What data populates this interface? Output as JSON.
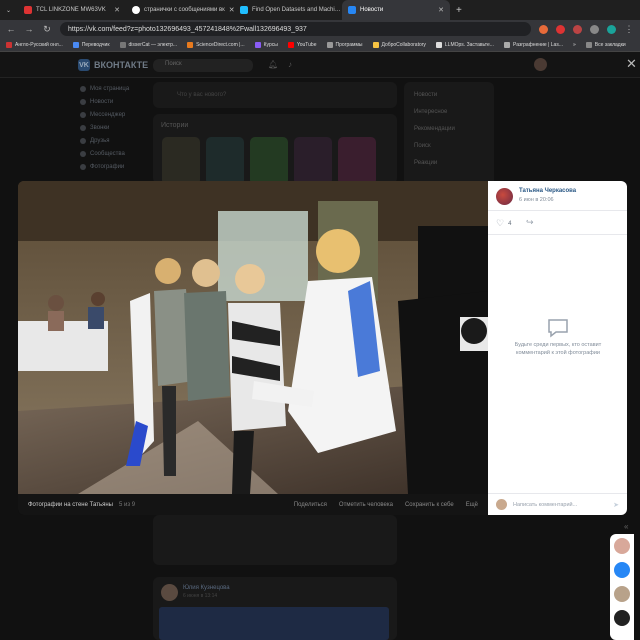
{
  "browser": {
    "tabs": [
      {
        "title": "TCL LINKZONE MW63VK",
        "color": "#d33"
      },
      {
        "title": "странички с сообщениями вк",
        "color": "#fff"
      },
      {
        "title": "Find Open Datasets and Machi…",
        "color": "#20beff"
      },
      {
        "title": "Новости",
        "color": "#2787f5"
      }
    ],
    "new_tab": "+",
    "url": "https://vk.com/feed?z=photo132696493_457241848%2Fwall132696493_937",
    "bookmarks": [
      "Англо-Русский онл...",
      "Переводчик",
      "disserCat — электр...",
      "ScienceDirect.com |...",
      "Курсы",
      "YouTube",
      "Программы",
      "ДоброCollaboratory",
      "LLMOps. Заставьте...",
      "Pазграфнение | Las..."
    ],
    "bookmarks_more": "»",
    "all_bookmarks": "Все закладки"
  },
  "vk": {
    "logo_text": "ВКОНТАКТЕ",
    "search_placeholder": "Поиск",
    "menu": [
      "Моя страница",
      "Новости",
      "Мессенджер",
      "Звонки",
      "Друзья",
      "Сообщества",
      "Фотографии"
    ],
    "new_post_placeholder": "Что у вас нового?",
    "stories_title": "Истории",
    "right_menu": [
      "Новости",
      "Интересное",
      "Рекомендации",
      "Поиск",
      "Реакции"
    ],
    "below_post": {
      "author": "Юлия Кузнецова",
      "date": "6 июня в 13:14"
    }
  },
  "viewer": {
    "caption": "Фотографии на стене Татьяны",
    "counter": "5 из 9",
    "actions": [
      "Поделиться",
      "Отметить человека",
      "Сохранить к себе",
      "Ещё"
    ],
    "author_name": "Татьяна Черкасова",
    "post_date": "6 июн в 20:06",
    "like_count": "4",
    "empty_comments": "Будьте среди первых, кто оставит комментарий к этой фотографии",
    "comment_placeholder": "Написать комментарий..."
  },
  "colors": {
    "vk_blue": "#2787f5",
    "link": "#2a5885"
  }
}
